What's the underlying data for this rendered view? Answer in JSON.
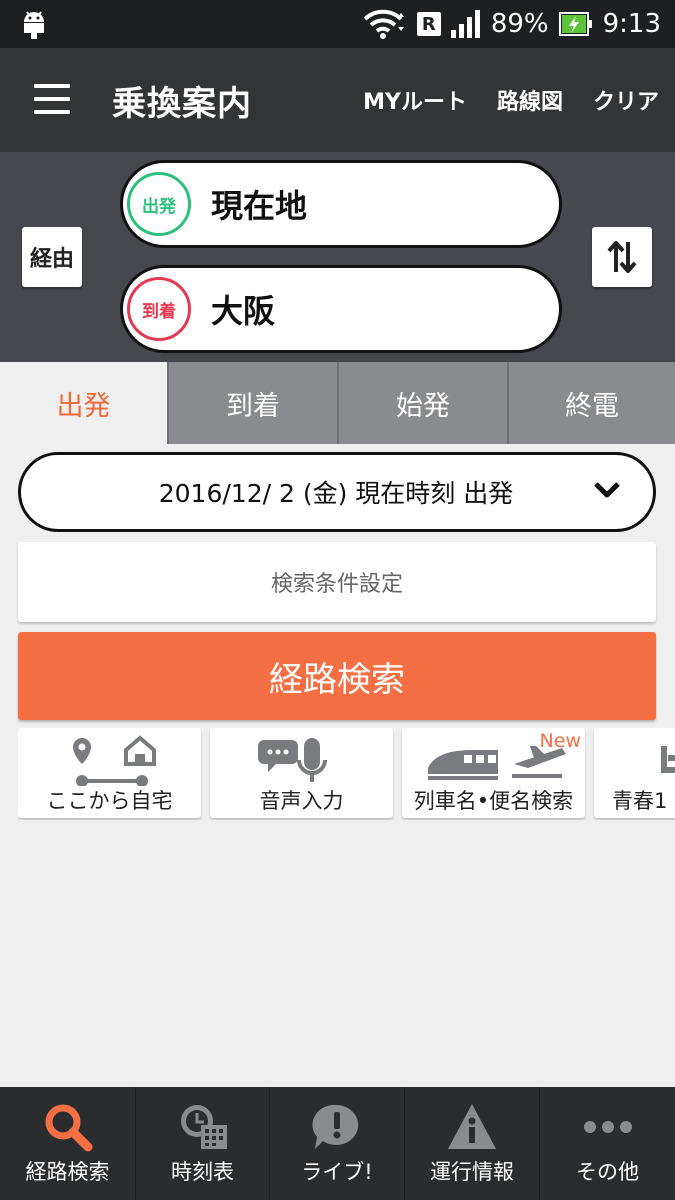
{
  "status_bar": {
    "battery": "89%",
    "time": "9:13",
    "network_badge": "R",
    "icons": [
      "android-icon",
      "wifi-icon",
      "signal-icon",
      "battery-charging-icon"
    ]
  },
  "header": {
    "title": "乗換案内",
    "links": [
      "MYルート",
      "路線図",
      "クリア"
    ]
  },
  "route": {
    "via_label": "経由",
    "departure": {
      "badge": "出発",
      "station": "現在地",
      "color": "#2dbf7c"
    },
    "arrival": {
      "badge": "到着",
      "station": "大阪",
      "color": "#e23a52"
    }
  },
  "tabs": [
    {
      "label": "出発",
      "active": true
    },
    {
      "label": "到着",
      "active": false
    },
    {
      "label": "始発",
      "active": false
    },
    {
      "label": "終電",
      "active": false
    }
  ],
  "datetime": {
    "label": "2016/12/ 2 (金) 現在時刻 出発"
  },
  "conditions_label": "検索条件設定",
  "search_label": "経路検索",
  "shortcuts": [
    {
      "label": "ここから自宅",
      "icon": "home-route-icon"
    },
    {
      "label": "音声入力",
      "icon": "microphone-icon"
    },
    {
      "label": "列車名•便名検索",
      "icon": "train-plane-icon",
      "new_tag": "New"
    },
    {
      "label": "青春1",
      "icon": "ticket-icon"
    }
  ],
  "bottom_nav": [
    {
      "label": "経路検索",
      "icon": "search-icon",
      "active": true
    },
    {
      "label": "時刻表",
      "icon": "timetable-icon",
      "active": false
    },
    {
      "label": "ライブ!",
      "icon": "live-alert-icon",
      "active": false
    },
    {
      "label": "運行情報",
      "icon": "warning-info-icon",
      "active": false
    },
    {
      "label": "その他",
      "icon": "more-icon",
      "active": false
    }
  ],
  "colors": {
    "accent": "#f56f45",
    "header_bg": "#333436",
    "panel_bg": "#47484e",
    "nav_bg": "#2b2c2e",
    "departure": "#2dbf7c",
    "arrival": "#e23a52"
  }
}
